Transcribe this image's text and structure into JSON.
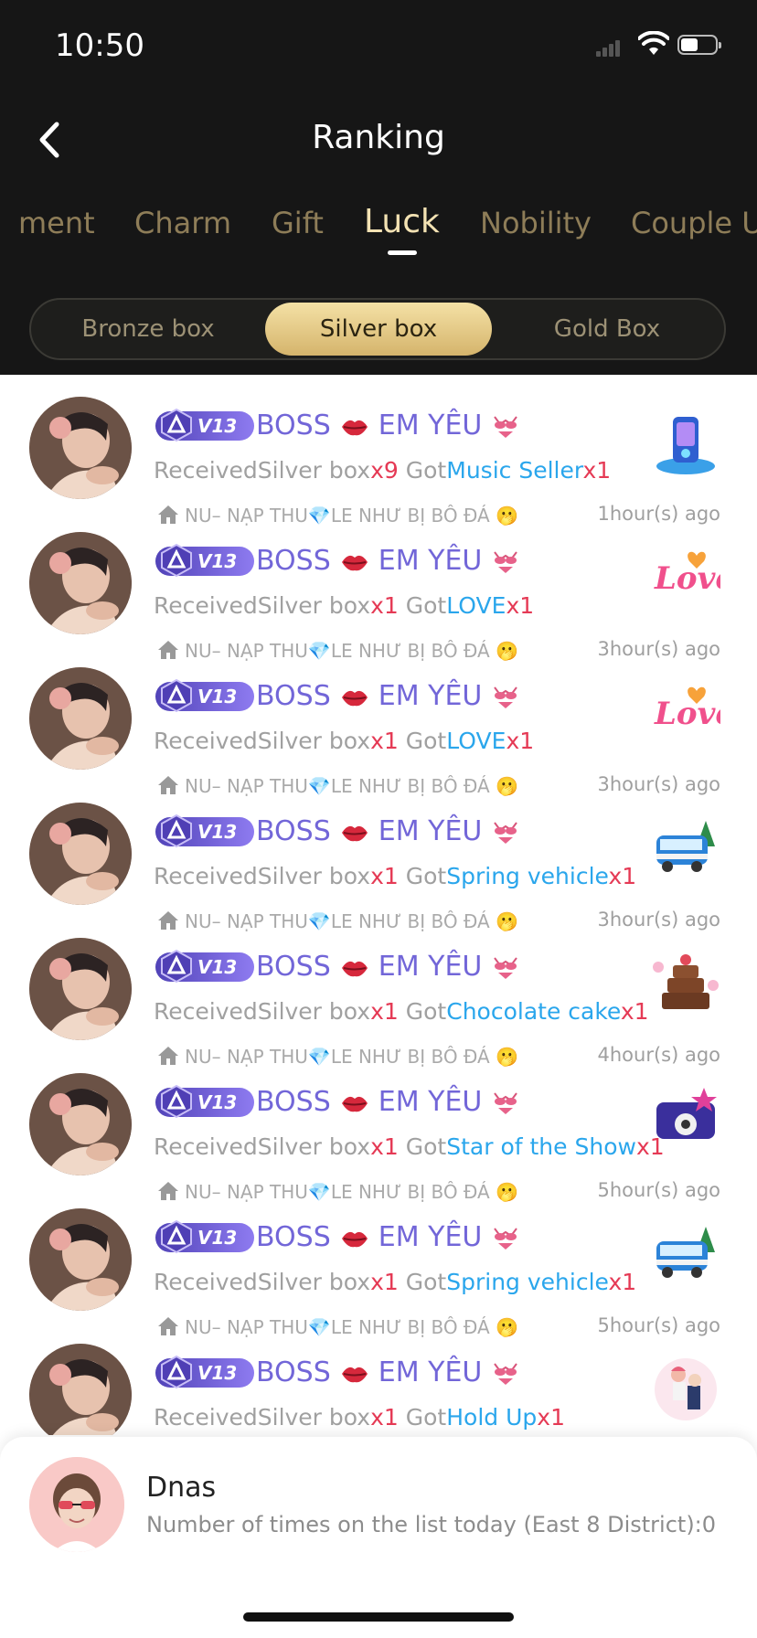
{
  "status_bar": {
    "time": "10:50",
    "battery_level": 0.5
  },
  "header": {
    "title": "Ranking"
  },
  "tabs": [
    {
      "label": "ment",
      "active": false
    },
    {
      "label": "Charm",
      "active": false
    },
    {
      "label": "Gift",
      "active": false
    },
    {
      "label": "Luck",
      "active": true
    },
    {
      "label": "Nobility",
      "active": false
    },
    {
      "label": "Couple U",
      "active": false
    }
  ],
  "segments": [
    {
      "label": "Bronze box",
      "active": false
    },
    {
      "label": "Silver box",
      "active": true
    },
    {
      "label": "Gold Box",
      "active": false
    }
  ],
  "colors": {
    "accent_gold": "#d5b46c",
    "name_purple": "#7266d8",
    "count_red": "#e53a55",
    "gift_blue": "#2aa6ec"
  },
  "entries": [
    {
      "level": "V13",
      "name_prefix": "BOSS",
      "name_suffix": "EM YÊU",
      "received_label": "Received",
      "box": "Silver box",
      "box_count": "x9",
      "got_label": "Got",
      "gift": "Music Seller",
      "gift_count": "x1",
      "room": "NU– NẠP THU💎LE NHƯ BỊ BÔ ĐÁ 🫢",
      "time": "1hour(s) ago",
      "gift_icon": "music-seller-gift-icon"
    },
    {
      "level": "V13",
      "name_prefix": "BOSS",
      "name_suffix": "EM YÊU",
      "received_label": "Received",
      "box": "Silver box",
      "box_count": "x1",
      "got_label": "Got",
      "gift": "LOVE",
      "gift_count": "x1",
      "room": "NU– NẠP THU💎LE NHƯ BỊ BÔ ĐÁ 🫢",
      "time": "3hour(s) ago",
      "gift_icon": "love-gift-icon"
    },
    {
      "level": "V13",
      "name_prefix": "BOSS",
      "name_suffix": "EM YÊU",
      "received_label": "Received",
      "box": "Silver box",
      "box_count": "x1",
      "got_label": "Got",
      "gift": "LOVE",
      "gift_count": "x1",
      "room": "NU– NẠP THU💎LE NHƯ BỊ BÔ ĐÁ 🫢",
      "time": "3hour(s) ago",
      "gift_icon": "love-gift-icon"
    },
    {
      "level": "V13",
      "name_prefix": "BOSS",
      "name_suffix": "EM YÊU",
      "received_label": "Received",
      "box": "Silver box",
      "box_count": "x1",
      "got_label": "Got",
      "gift": "Spring vehicle",
      "gift_count": "x1",
      "room": "NU– NẠP THU💎LE NHƯ BỊ BÔ ĐÁ 🫢",
      "time": "3hour(s) ago",
      "gift_icon": "spring-vehicle-gift-icon"
    },
    {
      "level": "V13",
      "name_prefix": "BOSS",
      "name_suffix": "EM YÊU",
      "received_label": "Received",
      "box": "Silver box",
      "box_count": "x1",
      "got_label": "Got",
      "gift": "Chocolate cake",
      "gift_count": "x1",
      "room": "NU– NẠP THU💎LE NHƯ BỊ BÔ ĐÁ 🫢",
      "time": "4hour(s) ago",
      "gift_icon": "chocolate-cake-gift-icon"
    },
    {
      "level": "V13",
      "name_prefix": "BOSS",
      "name_suffix": "EM YÊU",
      "received_label": "Received",
      "box": "Silver box",
      "box_count": "x1",
      "got_label": "Got",
      "gift": "Star of the Show",
      "gift_count": "x1",
      "room": "NU– NẠP THU💎LE NHƯ BỊ BÔ ĐÁ 🫢",
      "time": "5hour(s) ago",
      "gift_icon": "star-of-the-show-gift-icon"
    },
    {
      "level": "V13",
      "name_prefix": "BOSS",
      "name_suffix": "EM YÊU",
      "received_label": "Received",
      "box": "Silver box",
      "box_count": "x1",
      "got_label": "Got",
      "gift": "Spring vehicle",
      "gift_count": "x1",
      "room": "NU– NẠP THU💎LE NHƯ BỊ BÔ ĐÁ 🫢",
      "time": "5hour(s) ago",
      "gift_icon": "spring-vehicle-gift-icon"
    },
    {
      "level": "V13",
      "name_prefix": "BOSS",
      "name_suffix": "EM YÊU",
      "received_label": "Received",
      "box": "Silver box",
      "box_count": "x1",
      "got_label": "Got",
      "gift": "Hold Up",
      "gift_count": "x1",
      "room": "",
      "time": "",
      "gift_icon": "hold-up-gift-icon"
    }
  ],
  "my_rank": {
    "name": "Dnas",
    "info": "Number of times on the list today (East 8 District):0"
  }
}
